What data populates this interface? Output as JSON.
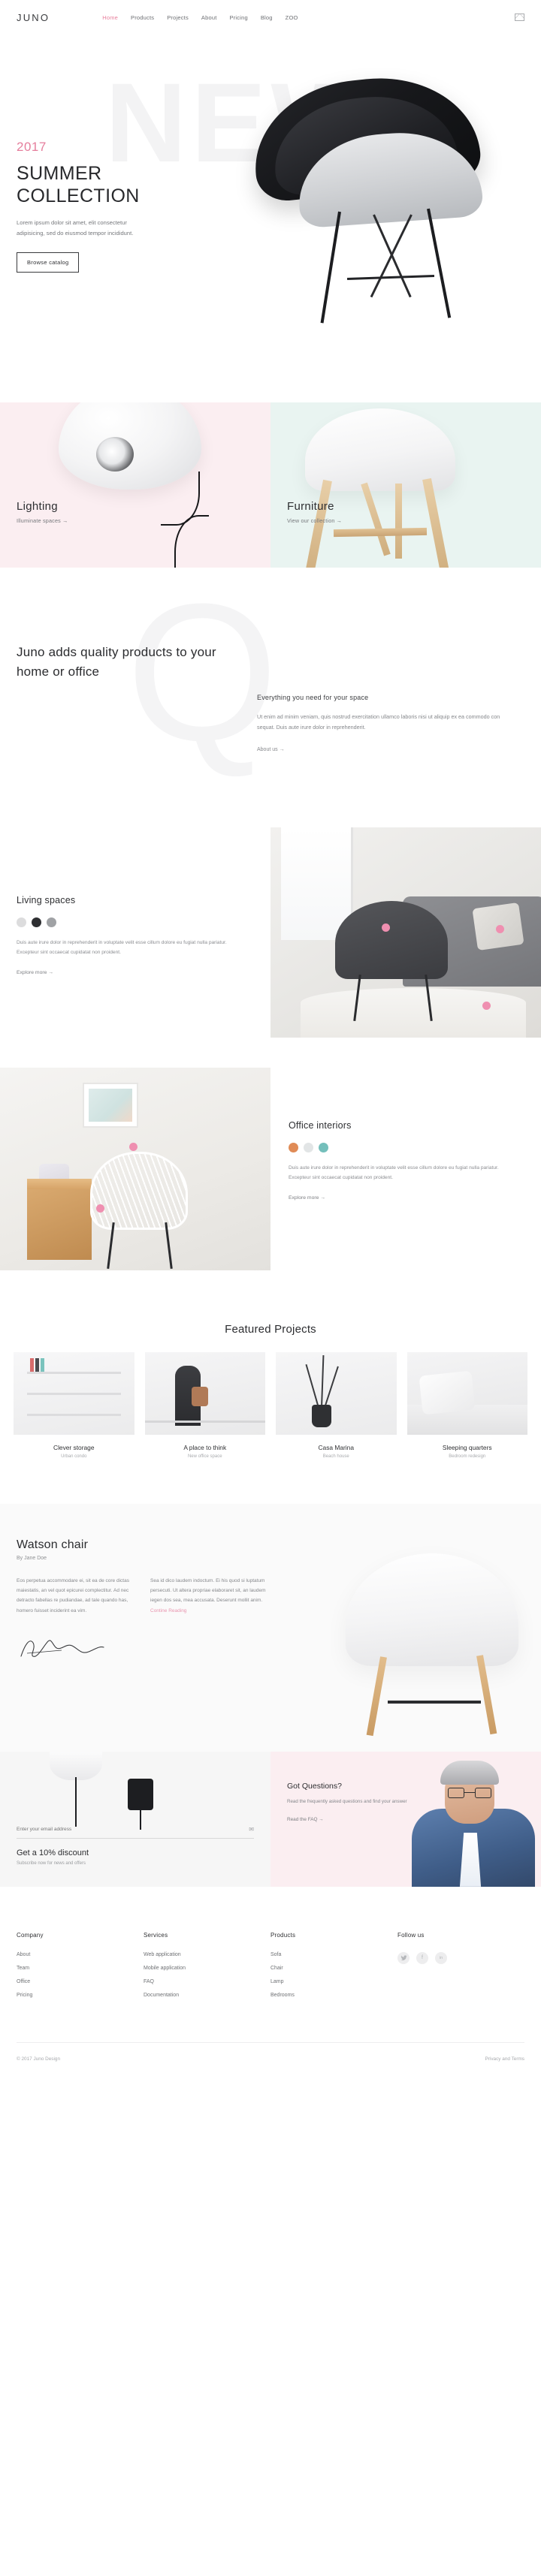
{
  "header": {
    "logo": "JUNO",
    "nav": [
      {
        "label": "Home",
        "active": true
      },
      {
        "label": "Products",
        "active": false
      },
      {
        "label": "Projects",
        "active": false
      },
      {
        "label": "About",
        "active": false
      },
      {
        "label": "Pricing",
        "active": false
      },
      {
        "label": "Blog",
        "active": false
      },
      {
        "label": "ZOO",
        "active": false
      }
    ],
    "mail_icon": "mail-icon"
  },
  "hero": {
    "ghost_word": "NEW",
    "year": "2017",
    "title_line1": "SUMMER",
    "title_line2": "COLLECTION",
    "paragraph": "Lorem ipsum dolor sit amet, elit consectetur adipisicing, sed do eiusmod tempor incididunt.",
    "button": "Browse catalog"
  },
  "cards": [
    {
      "title": "Lighting",
      "link": "Illuminate spaces →",
      "bg": "#fbeef1"
    },
    {
      "title": "Furniture",
      "link": "View our collection →",
      "bg": "#e9f4f1"
    }
  ],
  "quality": {
    "ghost_letter": "Q",
    "heading": "Juno adds quality products to your home or office",
    "sub": "Everything you need for your space",
    "body": "Ut enim ad minim veniam, quis nostrud exercitation ullamco laboris nisi ut aliquip ex ea commodo con sequat. Duis aute irure dolor in reprehenderit.",
    "link": "About us →"
  },
  "living": {
    "title": "Living spaces",
    "swatches": [
      "#dcdcdd",
      "#2e2f32",
      "#a0a2a5"
    ],
    "body": "Duis aute irure dolor in reprehenderit in voluptate velit esse cillum dolore eu fugiat nulla pariatur. Excepteur sint occaecat cupidatat non proident.",
    "link": "Explore more →"
  },
  "office": {
    "title": "Office interiors",
    "swatches": [
      "#e08b56",
      "#e2e5e6",
      "#74bfbb"
    ],
    "body": "Duis aute irure dolor in reprehenderit in voluptate velit esse cillum dolore eu fugiat nulla pariatur. Excepteur sint occaecat cupidatat non proident.",
    "link": "Explore more →"
  },
  "featured": {
    "title": "Featured Projects",
    "projects": [
      {
        "name": "Clever storage",
        "sub": "Urban condo"
      },
      {
        "name": "A place to think",
        "sub": "New office space"
      },
      {
        "name": "Casa Marina",
        "sub": "Beach house"
      },
      {
        "name": "Sleeping quarters",
        "sub": "Bedroom redesign"
      }
    ]
  },
  "watson": {
    "title": "Watson chair",
    "byline": "By Jane Doe",
    "column1": "Eos perpetua accommodare ei, sit ea de core dictas maiestatis, an vel quot epicurei complectitur. Ad nec detracto fabellas re pudiandae, ad tale quando has, homero fuisset inciderint ea vim.",
    "column2_text": "Sea id dico laudem indoctum. Ei his quod si luptatum persecuti. Ut altera propriae elaboraret sit, an laudem iegen dos sea, mea accusata. Deserunt mollit anim. ",
    "column2_link": "Contine Reading"
  },
  "promo": {
    "email_placeholder": "Enter your email address",
    "send_icon": "send-arrow-icon",
    "heading": "Get a 10% discount",
    "sub": "Subscribe now for news and offers"
  },
  "faq": {
    "heading": "Got Questions?",
    "body": "Read the frequently asked questions and find your answer",
    "link": "Read the FAQ →"
  },
  "footer": {
    "columns": [
      {
        "title": "Company",
        "links": [
          "About",
          "Team",
          "Office",
          "Pricing"
        ]
      },
      {
        "title": "Services",
        "links": [
          "Web application",
          "Mobile application",
          "FAQ",
          "Documentation"
        ]
      },
      {
        "title": "Products",
        "links": [
          "Sofa",
          "Chair",
          "Lamp",
          "Bedrooms"
        ]
      }
    ],
    "follow_title": "Follow us",
    "socials": [
      {
        "name": "twitter-icon",
        "glyph": "✓"
      },
      {
        "name": "facebook-icon",
        "glyph": "f"
      },
      {
        "name": "linkedin-icon",
        "glyph": "in"
      }
    ],
    "copyright": "© 2017 Juno Design",
    "privacy": "Privacy and Terms"
  }
}
